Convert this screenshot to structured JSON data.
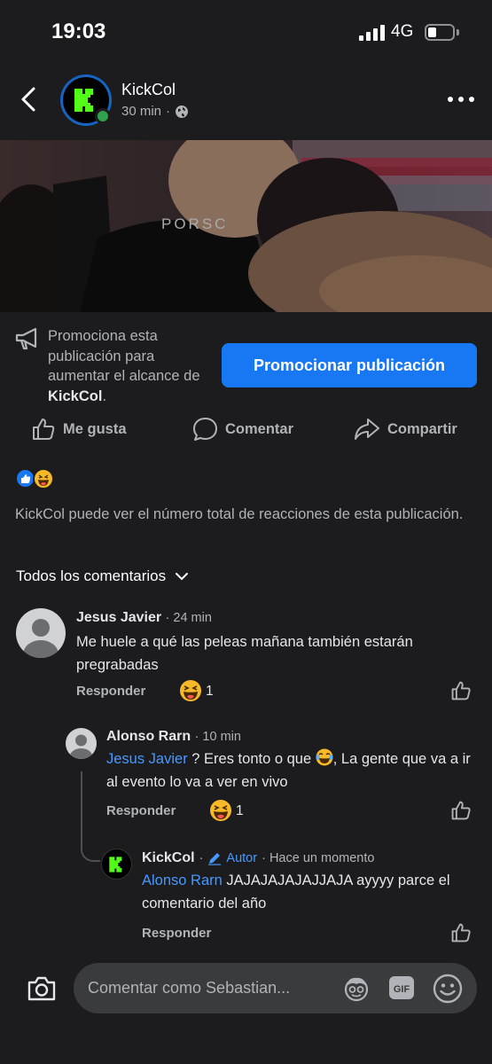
{
  "status_bar": {
    "time": "19:03",
    "network": "4G"
  },
  "post": {
    "page_name": "KickCol",
    "time_ago": "30 min",
    "separator": "·"
  },
  "promote": {
    "text_before": "Promociona esta publicación para aumentar el alcance de ",
    "text_bold": "KickCol",
    "text_after": ".",
    "button_label": "Promocionar publicación"
  },
  "actions": {
    "like": "Me gusta",
    "comment": "Comentar",
    "share": "Compartir"
  },
  "reaction_note": "KickCol puede ver el número total de reacciones de esta publicación.",
  "filter_label": "Todos los comentarios",
  "comments": [
    {
      "author": "Jesus Javier",
      "time": "· 24 min",
      "text": "Me huele a qué las peleas mañana también estarán pregrabadas",
      "reply_label": "Responder",
      "reaction_count": "1"
    },
    {
      "author": "Alonso Rarn",
      "time": "· 10 min",
      "mention": "Jesus Javier",
      "text_part1": " ? Eres tonto o que ",
      "text_part2": ", La gente que va a ir al evento lo va a ver en vivo",
      "reply_label": "Responder",
      "reaction_count": "1"
    },
    {
      "author": "KickCol",
      "dot": "·",
      "badge": "Autor",
      "time": "· Hace un momento",
      "mention": "Alonso Rarn",
      "text": " JAJAJAJAJAJJAJA ayyyy parce el comentario del año",
      "reply_label": "Responder"
    }
  ],
  "composer": {
    "placeholder": "Comentar como Sebastian..."
  },
  "colors": {
    "accent": "#1877f2",
    "mention": "#4599ff",
    "background": "#1c1c1e",
    "brand_green": "#53fc18"
  }
}
